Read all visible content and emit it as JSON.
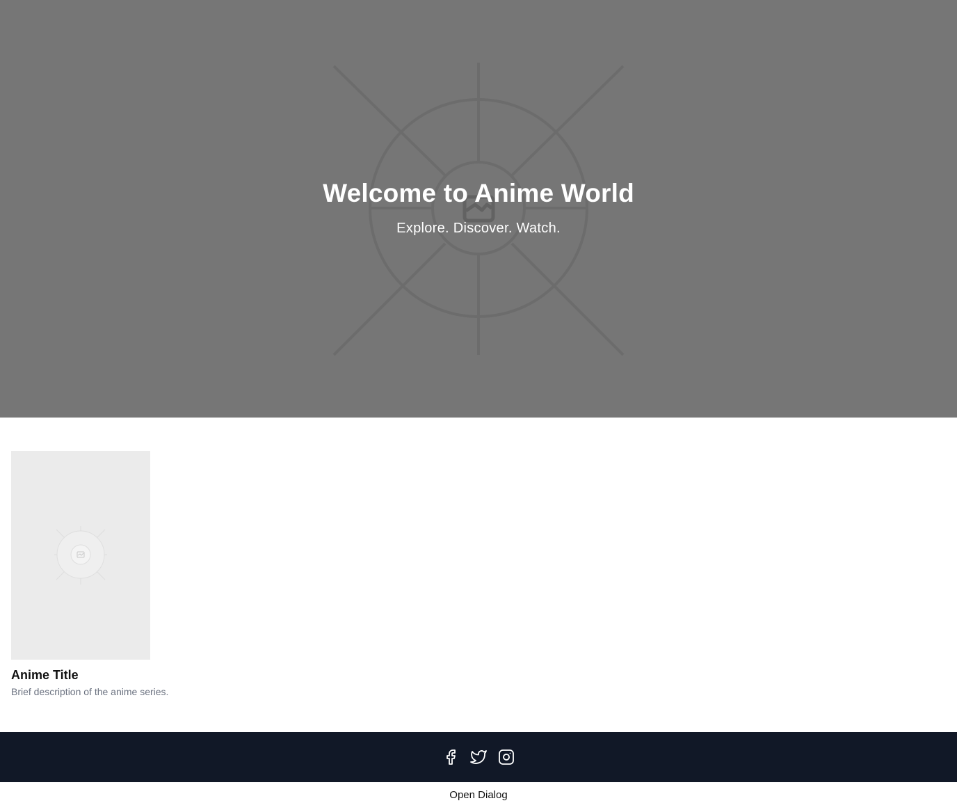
{
  "hero": {
    "title": "Welcome to Anime World",
    "subtitle": "Explore. Discover. Watch.",
    "background_icon": "image-placeholder-icon"
  },
  "cards": [
    {
      "title": "Anime Title",
      "description": "Brief description of the anime series.",
      "image_icon": "image-placeholder-icon"
    }
  ],
  "footer": {
    "social": [
      {
        "name": "facebook",
        "icon": "facebook-icon"
      },
      {
        "name": "twitter",
        "icon": "twitter-icon"
      },
      {
        "name": "instagram",
        "icon": "instagram-icon"
      }
    ],
    "background_color": "#111827"
  },
  "dialog": {
    "open_label": "Open Dialog"
  }
}
